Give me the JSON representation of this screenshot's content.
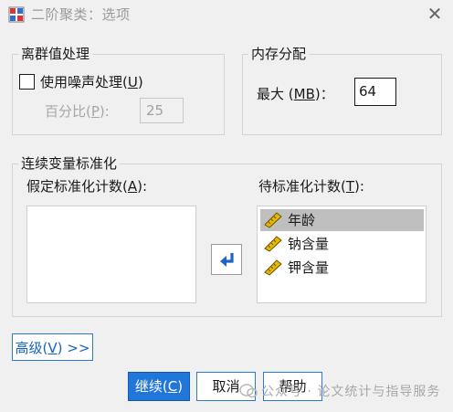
{
  "window": {
    "title": "二阶聚类：选项",
    "close_glyph": "✕"
  },
  "outlier": {
    "legend": "离群值处理",
    "noise_checkbox_label": "使用噪声处理(",
    "noise_checkbox_key": "U",
    "noise_checkbox_suffix": ")",
    "noise_checked": false,
    "percent_label": "百分比(",
    "percent_key": "P",
    "percent_suffix": "):",
    "percent_value": "25"
  },
  "memory": {
    "legend": "内存分配",
    "max_label": "最大 (",
    "max_key": "MB",
    "max_suffix": ")：",
    "max_value": "64"
  },
  "standardize": {
    "legend": "连续变量标准化",
    "assumed_label": "假定标准化计数(",
    "assumed_key": "A",
    "assumed_suffix": "):",
    "assumed_items": [],
    "pending_label": "待标准化计数(",
    "pending_key": "T",
    "pending_suffix": "):",
    "pending_items": [
      {
        "label": "年龄",
        "selected": true,
        "icon": "scale-ruler-icon"
      },
      {
        "label": "钠含量",
        "selected": false,
        "icon": "scale-ruler-icon"
      },
      {
        "label": "钾含量",
        "selected": false,
        "icon": "scale-ruler-icon"
      }
    ],
    "move_button_icon": "arrow-left-icon"
  },
  "buttons": {
    "advanced_label": "高级(",
    "advanced_key": "V",
    "advanced_suffix": ") >>",
    "continue_label": "继续(",
    "continue_key": "C",
    "continue_suffix": ")",
    "cancel_label": "取消",
    "help_label": "帮助"
  },
  "watermark": {
    "text": "公众号 · 论文统计与指导服务"
  },
  "colors": {
    "accent": "#2176d9",
    "selected_row": "#bfbfbf",
    "ruler_yellow": "#e0b400"
  }
}
